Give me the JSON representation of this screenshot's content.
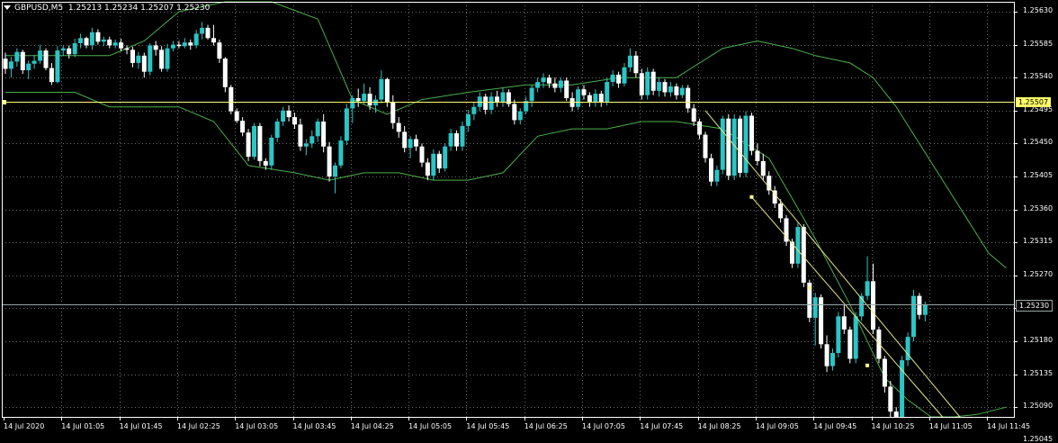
{
  "header": {
    "symbol": "GBPUSD,M5",
    "ohlc": "1.25213 1.25234 1.25207 1.25230"
  },
  "colors": {
    "background": "#000000",
    "grid": "#6b6b6b",
    "axis": "#ffffff",
    "bull": "#2bc5c5",
    "bear": "#ffffff",
    "bands": "#4caf4c",
    "level_line": "#ffff66",
    "bid_line": "#9aa6a6",
    "channel": "#e5e58a"
  },
  "price_labels": {
    "level": "1.25507",
    "bid": "1.25230"
  },
  "chart_data": {
    "type": "candlestick",
    "indicator": "Bollinger Bands",
    "timeframe": "M5",
    "ylim": [
      1.2503,
      1.2565
    ],
    "x_tick_labels": [
      "14 Jul 2020",
      "14 Jul 01:05",
      "14 Jul 01:45",
      "14 Jul 02:25",
      "14 Jul 03:05",
      "14 Jul 03:45",
      "14 Jul 04:25",
      "14 Jul 05:05",
      "14 Jul 05:45",
      "14 Jul 06:25",
      "14 Jul 07:05",
      "14 Jul 07:45",
      "14 Jul 08:25",
      "14 Jul 09:05",
      "14 Jul 09:45",
      "14 Jul 10:25",
      "14 Jul 11:05",
      "14 Jul 11:45"
    ],
    "y_tick_labels": [
      "1.25630",
      "1.25585",
      "1.25540",
      "1.25495",
      "1.25450",
      "1.25405",
      "1.25360",
      "1.25315",
      "1.25270",
      "1.25225",
      "1.25180",
      "1.25135",
      "1.25090",
      "1.25045"
    ],
    "y_tick_values": [
      1.2563,
      1.25585,
      1.2554,
      1.25495,
      1.2545,
      1.25405,
      1.2536,
      1.25315,
      1.2527,
      1.25225,
      1.2518,
      1.25135,
      1.2509,
      1.25045
    ],
    "horizontal_lines": [
      {
        "value": 1.25507,
        "label": "1.25507",
        "kind": "level"
      },
      {
        "value": 1.2523,
        "label": "1.25230",
        "kind": "bid"
      }
    ],
    "channel": {
      "upper": [
        [
          121,
          1.25495
        ],
        [
          165,
          1.25045
        ]
      ],
      "lower": [
        [
          129,
          1.25377
        ],
        [
          162,
          1.2503
        ]
      ],
      "anchor_points": [
        [
          129,
          1.25377
        ],
        [
          139,
          1.25253
        ],
        [
          149,
          1.25147
        ]
      ]
    },
    "bands_upper": [
      [
        0,
        1.2557
      ],
      [
        12,
        1.2557
      ],
      [
        18,
        1.2557
      ],
      [
        24,
        1.2559
      ],
      [
        30,
        1.2563
      ],
      [
        38,
        1.2565
      ],
      [
        46,
        1.2565
      ],
      [
        54,
        1.2562
      ],
      [
        60,
        1.2551
      ],
      [
        66,
        1.2549
      ],
      [
        72,
        1.2551
      ],
      [
        80,
        1.2552
      ],
      [
        90,
        1.2553
      ],
      [
        98,
        1.2553
      ],
      [
        106,
        1.2554
      ],
      [
        116,
        1.2554
      ],
      [
        124,
        1.2558
      ],
      [
        130,
        1.2559
      ],
      [
        136,
        1.2558
      ],
      [
        140,
        1.2557
      ],
      [
        146,
        1.2556
      ],
      [
        150,
        1.2554
      ],
      [
        154,
        1.255
      ],
      [
        158,
        1.2545
      ],
      [
        162,
        1.254
      ],
      [
        166,
        1.2535
      ],
      [
        170,
        1.253
      ],
      [
        173,
        1.2528
      ]
    ],
    "bands_lower": [
      [
        0,
        1.2552
      ],
      [
        12,
        1.2552
      ],
      [
        18,
        1.255
      ],
      [
        24,
        1.255
      ],
      [
        30,
        1.255
      ],
      [
        36,
        1.2548
      ],
      [
        42,
        1.2542
      ],
      [
        50,
        1.2541
      ],
      [
        56,
        1.254
      ],
      [
        62,
        1.2541
      ],
      [
        68,
        1.2541
      ],
      [
        74,
        1.254
      ],
      [
        80,
        1.254
      ],
      [
        86,
        1.2541
      ],
      [
        92,
        1.2546
      ],
      [
        98,
        1.2547
      ],
      [
        104,
        1.2547
      ],
      [
        110,
        1.2548
      ],
      [
        116,
        1.2548
      ],
      [
        124,
        1.2547
      ],
      [
        132,
        1.2543
      ],
      [
        140,
        1.2532
      ],
      [
        146,
        1.2523
      ],
      [
        152,
        1.2513
      ],
      [
        156,
        1.251
      ],
      [
        160,
        1.2506
      ],
      [
        164,
        1.2504
      ],
      [
        168,
        1.2508
      ],
      [
        173,
        1.2509
      ]
    ],
    "candles": [
      [
        1.25566,
        1.25574,
        1.25545,
        1.25552
      ],
      [
        1.25552,
        1.25568,
        1.2554,
        1.25562
      ],
      [
        1.25562,
        1.2558,
        1.25555,
        1.25575
      ],
      [
        1.25575,
        1.25578,
        1.25545,
        1.2555
      ],
      [
        1.2555,
        1.25563,
        1.25538,
        1.25559
      ],
      [
        1.25559,
        1.25571,
        1.25552,
        1.25563
      ],
      [
        1.25563,
        1.25585,
        1.25559,
        1.25577
      ],
      [
        1.25577,
        1.2558,
        1.2555,
        1.25553
      ],
      [
        1.25553,
        1.2556,
        1.2553,
        1.25534
      ],
      [
        1.25534,
        1.25583,
        1.25532,
        1.25577
      ],
      [
        1.25577,
        1.25584,
        1.2557,
        1.2558
      ],
      [
        1.2558,
        1.25584,
        1.25566,
        1.25572
      ],
      [
        1.25572,
        1.25593,
        1.25568,
        1.25587
      ],
      [
        1.25587,
        1.256,
        1.2558,
        1.25594
      ],
      [
        1.25594,
        1.25596,
        1.2558,
        1.25584
      ],
      [
        1.25584,
        1.25608,
        1.25578,
        1.25602
      ],
      [
        1.25602,
        1.25606,
        1.25585,
        1.25589
      ],
      [
        1.25589,
        1.25596,
        1.25583,
        1.25592
      ],
      [
        1.25592,
        1.25596,
        1.2558,
        1.25584
      ],
      [
        1.25584,
        1.25592,
        1.2558,
        1.25588
      ],
      [
        1.25588,
        1.25593,
        1.25576,
        1.2558
      ],
      [
        1.2558,
        1.25584,
        1.25572,
        1.25578
      ],
      [
        1.25578,
        1.25582,
        1.25554,
        1.2556
      ],
      [
        1.2556,
        1.25575,
        1.25552,
        1.2557
      ],
      [
        1.2557,
        1.25574,
        1.2554,
        1.25548
      ],
      [
        1.25548,
        1.25587,
        1.25543,
        1.25584
      ],
      [
        1.25584,
        1.2559,
        1.2557,
        1.25578
      ],
      [
        1.25578,
        1.25583,
        1.25548,
        1.25552
      ],
      [
        1.25552,
        1.25586,
        1.25548,
        1.2558
      ],
      [
        1.2558,
        1.2559,
        1.25576,
        1.25585
      ],
      [
        1.25585,
        1.2559,
        1.2558,
        1.25583
      ],
      [
        1.25583,
        1.25594,
        1.2558,
        1.25588
      ],
      [
        1.25588,
        1.25592,
        1.25578,
        1.25584
      ],
      [
        1.25584,
        1.25605,
        1.2558,
        1.256
      ],
      [
        1.256,
        1.25616,
        1.25592,
        1.25608
      ],
      [
        1.25608,
        1.25612,
        1.25592,
        1.25594
      ],
      [
        1.25594,
        1.25612,
        1.25584,
        1.25588
      ],
      [
        1.25588,
        1.25592,
        1.2556,
        1.25566
      ],
      [
        1.25566,
        1.25568,
        1.2552,
        1.25527
      ],
      [
        1.25527,
        1.2553,
        1.2549,
        1.25494
      ],
      [
        1.25494,
        1.25498,
        1.25478,
        1.25481
      ],
      [
        1.25481,
        1.25486,
        1.2546,
        1.25465
      ],
      [
        1.25465,
        1.2547,
        1.25426,
        1.25432
      ],
      [
        1.25432,
        1.25478,
        1.25428,
        1.25474
      ],
      [
        1.25474,
        1.25478,
        1.25419,
        1.25426
      ],
      [
        1.25426,
        1.2543,
        1.25414,
        1.2542
      ],
      [
        1.2542,
        1.25462,
        1.25414,
        1.25458
      ],
      [
        1.25458,
        1.25484,
        1.25452,
        1.2548
      ],
      [
        1.2548,
        1.255,
        1.25474,
        1.25495
      ],
      [
        1.25495,
        1.25502,
        1.2548,
        1.25486
      ],
      [
        1.25486,
        1.25492,
        1.2547,
        1.25476
      ],
      [
        1.25476,
        1.25484,
        1.2544,
        1.25446
      ],
      [
        1.25446,
        1.25456,
        1.25434,
        1.2545
      ],
      [
        1.2545,
        1.25468,
        1.25444,
        1.2546
      ],
      [
        1.2546,
        1.25484,
        1.25452,
        1.2548
      ],
      [
        1.2548,
        1.2549,
        1.25438,
        1.25446
      ],
      [
        1.25446,
        1.25452,
        1.25398,
        1.25405
      ],
      [
        1.25405,
        1.25424,
        1.25382,
        1.2542
      ],
      [
        1.2542,
        1.2546,
        1.25416,
        1.25454
      ],
      [
        1.25454,
        1.25504,
        1.25448,
        1.25498
      ],
      [
        1.25498,
        1.25516,
        1.25478,
        1.25512
      ],
      [
        1.25512,
        1.25525,
        1.255,
        1.25508
      ],
      [
        1.25508,
        1.25532,
        1.25504,
        1.25518
      ],
      [
        1.25518,
        1.25527,
        1.25496,
        1.25502
      ],
      [
        1.25502,
        1.25516,
        1.25492,
        1.2551
      ],
      [
        1.2551,
        1.2555,
        1.25505,
        1.25538
      ],
      [
        1.25538,
        1.2554,
        1.255,
        1.25506
      ],
      [
        1.25506,
        1.25516,
        1.2547,
        1.25478
      ],
      [
        1.25478,
        1.25486,
        1.25458,
        1.25466
      ],
      [
        1.25466,
        1.25474,
        1.25438,
        1.25444
      ],
      [
        1.25444,
        1.2546,
        1.2543,
        1.25456
      ],
      [
        1.25456,
        1.25462,
        1.2544,
        1.25446
      ],
      [
        1.25446,
        1.2545,
        1.25418,
        1.25424
      ],
      [
        1.25424,
        1.2543,
        1.254,
        1.25406
      ],
      [
        1.25406,
        1.25442,
        1.254,
        1.25436
      ],
      [
        1.25436,
        1.2544,
        1.2541,
        1.25416
      ],
      [
        1.25416,
        1.2545,
        1.25412,
        1.25446
      ],
      [
        1.25446,
        1.2547,
        1.2544,
        1.25464
      ],
      [
        1.25464,
        1.25468,
        1.2544,
        1.25446
      ],
      [
        1.25446,
        1.2548,
        1.2544,
        1.25474
      ],
      [
        1.25474,
        1.25496,
        1.25466,
        1.2549
      ],
      [
        1.2549,
        1.25506,
        1.25482,
        1.255
      ],
      [
        1.255,
        1.2552,
        1.25494,
        1.25514
      ],
      [
        1.25514,
        1.25518,
        1.2549,
        1.25496
      ],
      [
        1.25496,
        1.2552,
        1.2549,
        1.25514
      ],
      [
        1.25514,
        1.25522,
        1.255,
        1.25506
      ],
      [
        1.25506,
        1.25526,
        1.255,
        1.2552
      ],
      [
        1.2552,
        1.25524,
        1.255,
        1.25504
      ],
      [
        1.25504,
        1.2551,
        1.25476,
        1.25482
      ],
      [
        1.25482,
        1.25498,
        1.25476,
        1.25494
      ],
      [
        1.25494,
        1.25514,
        1.2549,
        1.25508
      ],
      [
        1.25508,
        1.2553,
        1.255,
        1.25526
      ],
      [
        1.25526,
        1.2554,
        1.2552,
        1.25534
      ],
      [
        1.25534,
        1.25546,
        1.25526,
        1.2554
      ],
      [
        1.2554,
        1.25544,
        1.25526,
        1.25532
      ],
      [
        1.25532,
        1.2554,
        1.2552,
        1.25526
      ],
      [
        1.25526,
        1.2554,
        1.2552,
        1.25536
      ],
      [
        1.25536,
        1.2554,
        1.25508,
        1.25512
      ],
      [
        1.25512,
        1.2552,
        1.25494,
        1.255
      ],
      [
        1.255,
        1.25528,
        1.25496,
        1.25524
      ],
      [
        1.25524,
        1.2553,
        1.2551,
        1.25516
      ],
      [
        1.25516,
        1.2552,
        1.255,
        1.25506
      ],
      [
        1.25506,
        1.25524,
        1.255,
        1.25518
      ],
      [
        1.25518,
        1.25522,
        1.255,
        1.25506
      ],
      [
        1.25506,
        1.2554,
        1.25502,
        1.25534
      ],
      [
        1.25534,
        1.2555,
        1.25528,
        1.25544
      ],
      [
        1.25544,
        1.25548,
        1.25526,
        1.25532
      ],
      [
        1.25532,
        1.2556,
        1.25528,
        1.25554
      ],
      [
        1.25554,
        1.2558,
        1.25548,
        1.2557
      ],
      [
        1.2557,
        1.25576,
        1.2554,
        1.25546
      ],
      [
        1.25546,
        1.25552,
        1.2551,
        1.25516
      ],
      [
        1.25516,
        1.25554,
        1.2551,
        1.25548
      ],
      [
        1.25548,
        1.25552,
        1.25516,
        1.25522
      ],
      [
        1.25522,
        1.2554,
        1.25514,
        1.25534
      ],
      [
        1.25534,
        1.25538,
        1.25514,
        1.2552
      ],
      [
        1.2552,
        1.25534,
        1.25514,
        1.25528
      ],
      [
        1.25528,
        1.25532,
        1.2551,
        1.25516
      ],
      [
        1.25516,
        1.2553,
        1.25512,
        1.25526
      ],
      [
        1.25526,
        1.2553,
        1.25492,
        1.25498
      ],
      [
        1.25498,
        1.25504,
        1.25474,
        1.2548
      ],
      [
        1.2548,
        1.25484,
        1.25456,
        1.25462
      ],
      [
        1.25462,
        1.25466,
        1.25424,
        1.2543
      ],
      [
        1.2543,
        1.25436,
        1.25392,
        1.25398
      ],
      [
        1.25398,
        1.2542,
        1.25392,
        1.25414
      ],
      [
        1.25414,
        1.25488,
        1.25408,
        1.25484
      ],
      [
        1.25484,
        1.2549,
        1.254,
        1.25406
      ],
      [
        1.25406,
        1.2549,
        1.254,
        1.25484
      ],
      [
        1.25484,
        1.25488,
        1.25404,
        1.2541
      ],
      [
        1.2541,
        1.25494,
        1.25404,
        1.25488
      ],
      [
        1.25488,
        1.25492,
        1.25434,
        1.2544
      ],
      [
        1.2544,
        1.2545,
        1.2542,
        1.25426
      ],
      [
        1.25426,
        1.25436,
        1.254,
        1.25406
      ],
      [
        1.25406,
        1.25412,
        1.2538,
        1.25386
      ],
      [
        1.25386,
        1.25392,
        1.25362,
        1.25368
      ],
      [
        1.25368,
        1.25374,
        1.25342,
        1.25348
      ],
      [
        1.25348,
        1.25352,
        1.2531,
        1.25316
      ],
      [
        1.25316,
        1.2532,
        1.2528,
        1.25286
      ],
      [
        1.25286,
        1.25342,
        1.2528,
        1.25336
      ],
      [
        1.25336,
        1.2534,
        1.25254,
        1.2526
      ],
      [
        1.2526,
        1.25264,
        1.25206,
        1.25212
      ],
      [
        1.25212,
        1.25246,
        1.25174,
        1.2524
      ],
      [
        1.2524,
        1.25244,
        1.2517,
        1.25176
      ],
      [
        1.25176,
        1.25188,
        1.25138,
        1.25146
      ],
      [
        1.25146,
        1.2517,
        1.2514,
        1.25164
      ],
      [
        1.25164,
        1.2522,
        1.25158,
        1.25214
      ],
      [
        1.25214,
        1.2523,
        1.2519,
        1.25196
      ],
      [
        1.25196,
        1.252,
        1.2515,
        1.25156
      ],
      [
        1.25156,
        1.2522,
        1.2515,
        1.25214
      ],
      [
        1.25214,
        1.25246,
        1.25208,
        1.25242
      ],
      [
        1.25242,
        1.25296,
        1.25236,
        1.25262
      ],
      [
        1.25262,
        1.25286,
        1.2519,
        1.25196
      ],
      [
        1.25196,
        1.252,
        1.2515,
        1.25156
      ],
      [
        1.25156,
        1.2516,
        1.2511,
        1.25118
      ],
      [
        1.25118,
        1.25126,
        1.25076,
        1.25084
      ],
      [
        1.25084,
        1.2509,
        1.25054,
        1.2506
      ],
      [
        1.2506,
        1.2516,
        1.25052,
        1.25154
      ],
      [
        1.25154,
        1.25192,
        1.25146,
        1.25186
      ],
      [
        1.25186,
        1.2525,
        1.2518,
        1.25242
      ],
      [
        1.25242,
        1.25246,
        1.2521,
        1.25216
      ],
      [
        1.25216,
        1.25234,
        1.25207,
        1.2523
      ]
    ]
  }
}
